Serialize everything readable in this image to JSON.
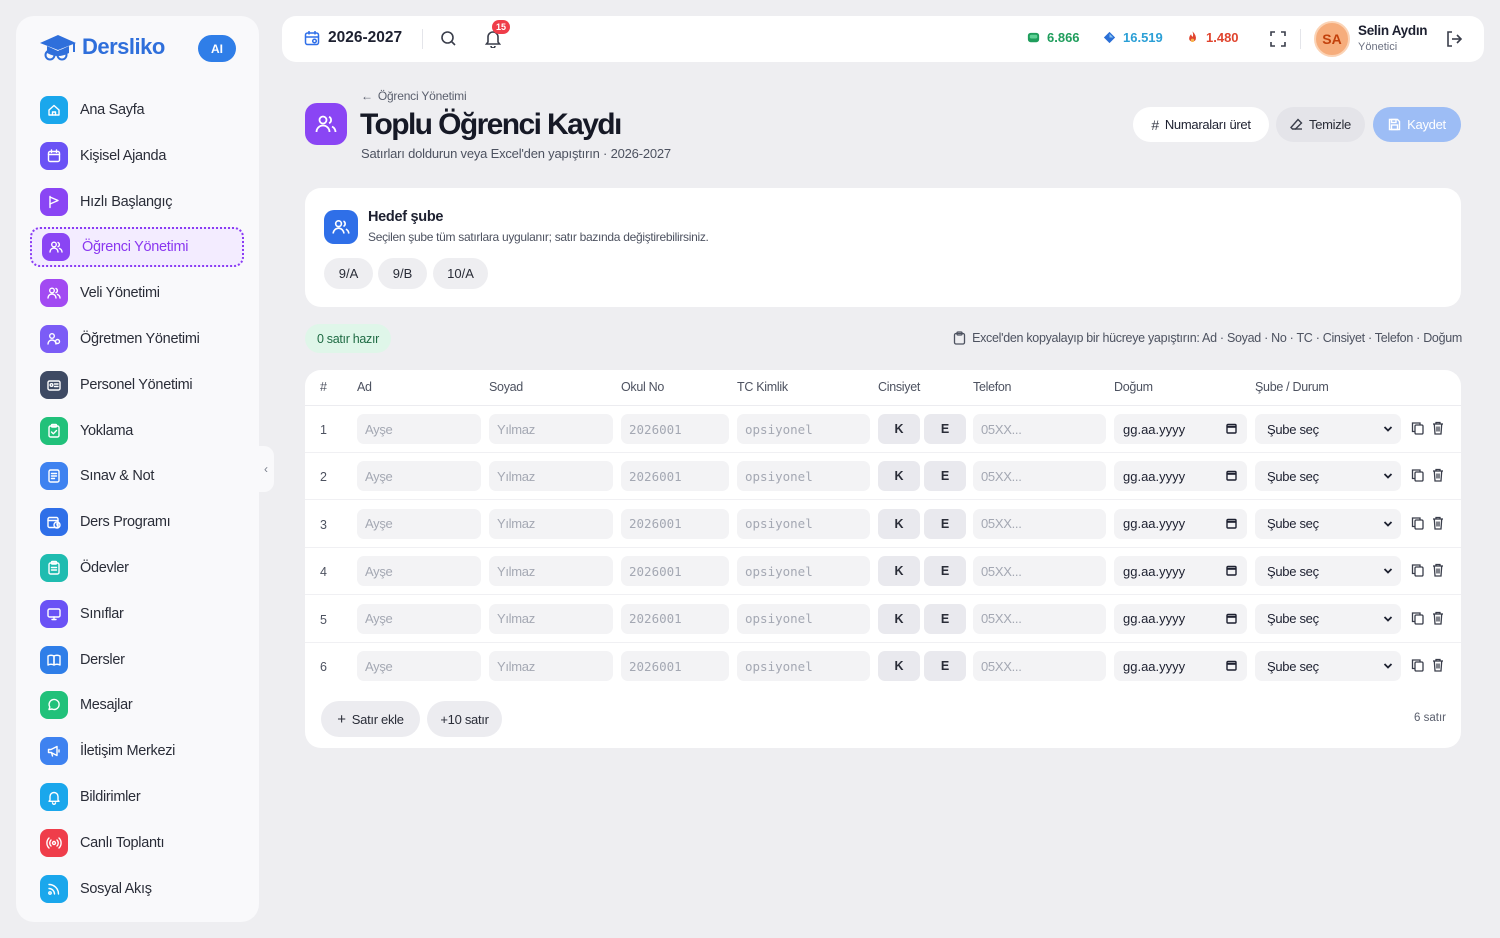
{
  "app": {
    "name": "Dersliko",
    "ai_badge": "AI"
  },
  "sidebar": {
    "items": [
      {
        "label": "Ana Sayfa",
        "icon": "home-icon",
        "color": "#1aa7ec"
      },
      {
        "label": "Kişisel Ajanda",
        "icon": "calendar-icon",
        "color": "#6a52f5"
      },
      {
        "label": "Hızlı Başlangıç",
        "icon": "flag-icon",
        "color": "#8a45f4"
      },
      {
        "label": "Öğrenci Yönetimi",
        "icon": "users-icon",
        "color": "#8a45f4",
        "active": true
      },
      {
        "label": "Veli Yönetimi",
        "icon": "users-icon",
        "color": "#a24af2"
      },
      {
        "label": "Öğretmen Yönetimi",
        "icon": "teacher-icon",
        "color": "#7b5cf6"
      },
      {
        "label": "Personel Yönetimi",
        "icon": "id-card-icon",
        "color": "#3e4a63"
      },
      {
        "label": "Yoklama",
        "icon": "clipboard-check-icon",
        "color": "#21c17a"
      },
      {
        "label": "Sınav & Not",
        "icon": "document-icon",
        "color": "#3e82f0"
      },
      {
        "label": "Ders Programı",
        "icon": "calendar-clock-icon",
        "color": "#2f6fe8"
      },
      {
        "label": "Ödevler",
        "icon": "clipboard-icon",
        "color": "#1fbcb0"
      },
      {
        "label": "Sınıflar",
        "icon": "monitor-icon",
        "color": "#6a52f5"
      },
      {
        "label": "Dersler",
        "icon": "book-icon",
        "color": "#2f7ee8"
      },
      {
        "label": "Mesajlar",
        "icon": "chat-icon",
        "color": "#21c17a"
      },
      {
        "label": "İletişim Merkezi",
        "icon": "megaphone-icon",
        "color": "#3e82f0"
      },
      {
        "label": "Bildirimler",
        "icon": "bell-icon",
        "color": "#1aa7ec"
      },
      {
        "label": "Canlı Toplantı",
        "icon": "broadcast-icon",
        "color": "#ef3d4a"
      },
      {
        "label": "Sosyal Akış",
        "icon": "rss-icon",
        "color": "#1aa7ec"
      }
    ]
  },
  "topbar": {
    "year": "2026-2027",
    "notifications": "15",
    "stats": [
      {
        "value": "6.866",
        "icon": "gem-green-icon",
        "color": "#1f9d5c"
      },
      {
        "value": "16.519",
        "icon": "gem-blue-icon",
        "color": "#2b9fd6"
      },
      {
        "value": "1.480",
        "icon": "flame-icon",
        "color": "#e0442e"
      }
    ],
    "user": {
      "initials": "SA",
      "name": "Selin Aydın",
      "role": "Yönetici"
    }
  },
  "page": {
    "breadcrumb": "Öğrenci Yönetimi",
    "title": "Toplu Öğrenci Kaydı",
    "subtitle": "Satırları doldurun veya Excel'den yapıştırın · 2026-2027",
    "buttons": {
      "numbers": "Numaraları üret",
      "clear": "Temizle",
      "save": "Kaydet"
    }
  },
  "target": {
    "title": "Hedef şube",
    "subtitle": "Seçilen şube tüm satırlara uygulanır; satır bazında değiştirebilirsiniz.",
    "options": [
      "9/A",
      "9/B",
      "10/A"
    ]
  },
  "status": {
    "ready": "0 satır hazır",
    "hint": "Excel'den kopyalayıp bir hücreye yapıştırın: Ad · Soyad · No · TC · Cinsiyet · Telefon · Doğum"
  },
  "table": {
    "headers": [
      "#",
      "Ad",
      "Soyad",
      "Okul No",
      "TC Kimlik",
      "Cinsiyet",
      "Telefon",
      "Doğum",
      "Şube / Durum"
    ],
    "placeholders": {
      "ad": "Ayşe",
      "soyad": "Yılmaz",
      "no": "2026001",
      "tc": "opsiyonel",
      "phone": "05XX...",
      "date": "gg.aa.yyyy",
      "branch": "Şube seç"
    },
    "sex": {
      "female": "K",
      "male": "E"
    },
    "rows": [
      "1",
      "2",
      "3",
      "4",
      "5",
      "6"
    ],
    "add_row": "Satır ekle",
    "add_ten": "+10 satır",
    "row_count": "6 satır"
  }
}
